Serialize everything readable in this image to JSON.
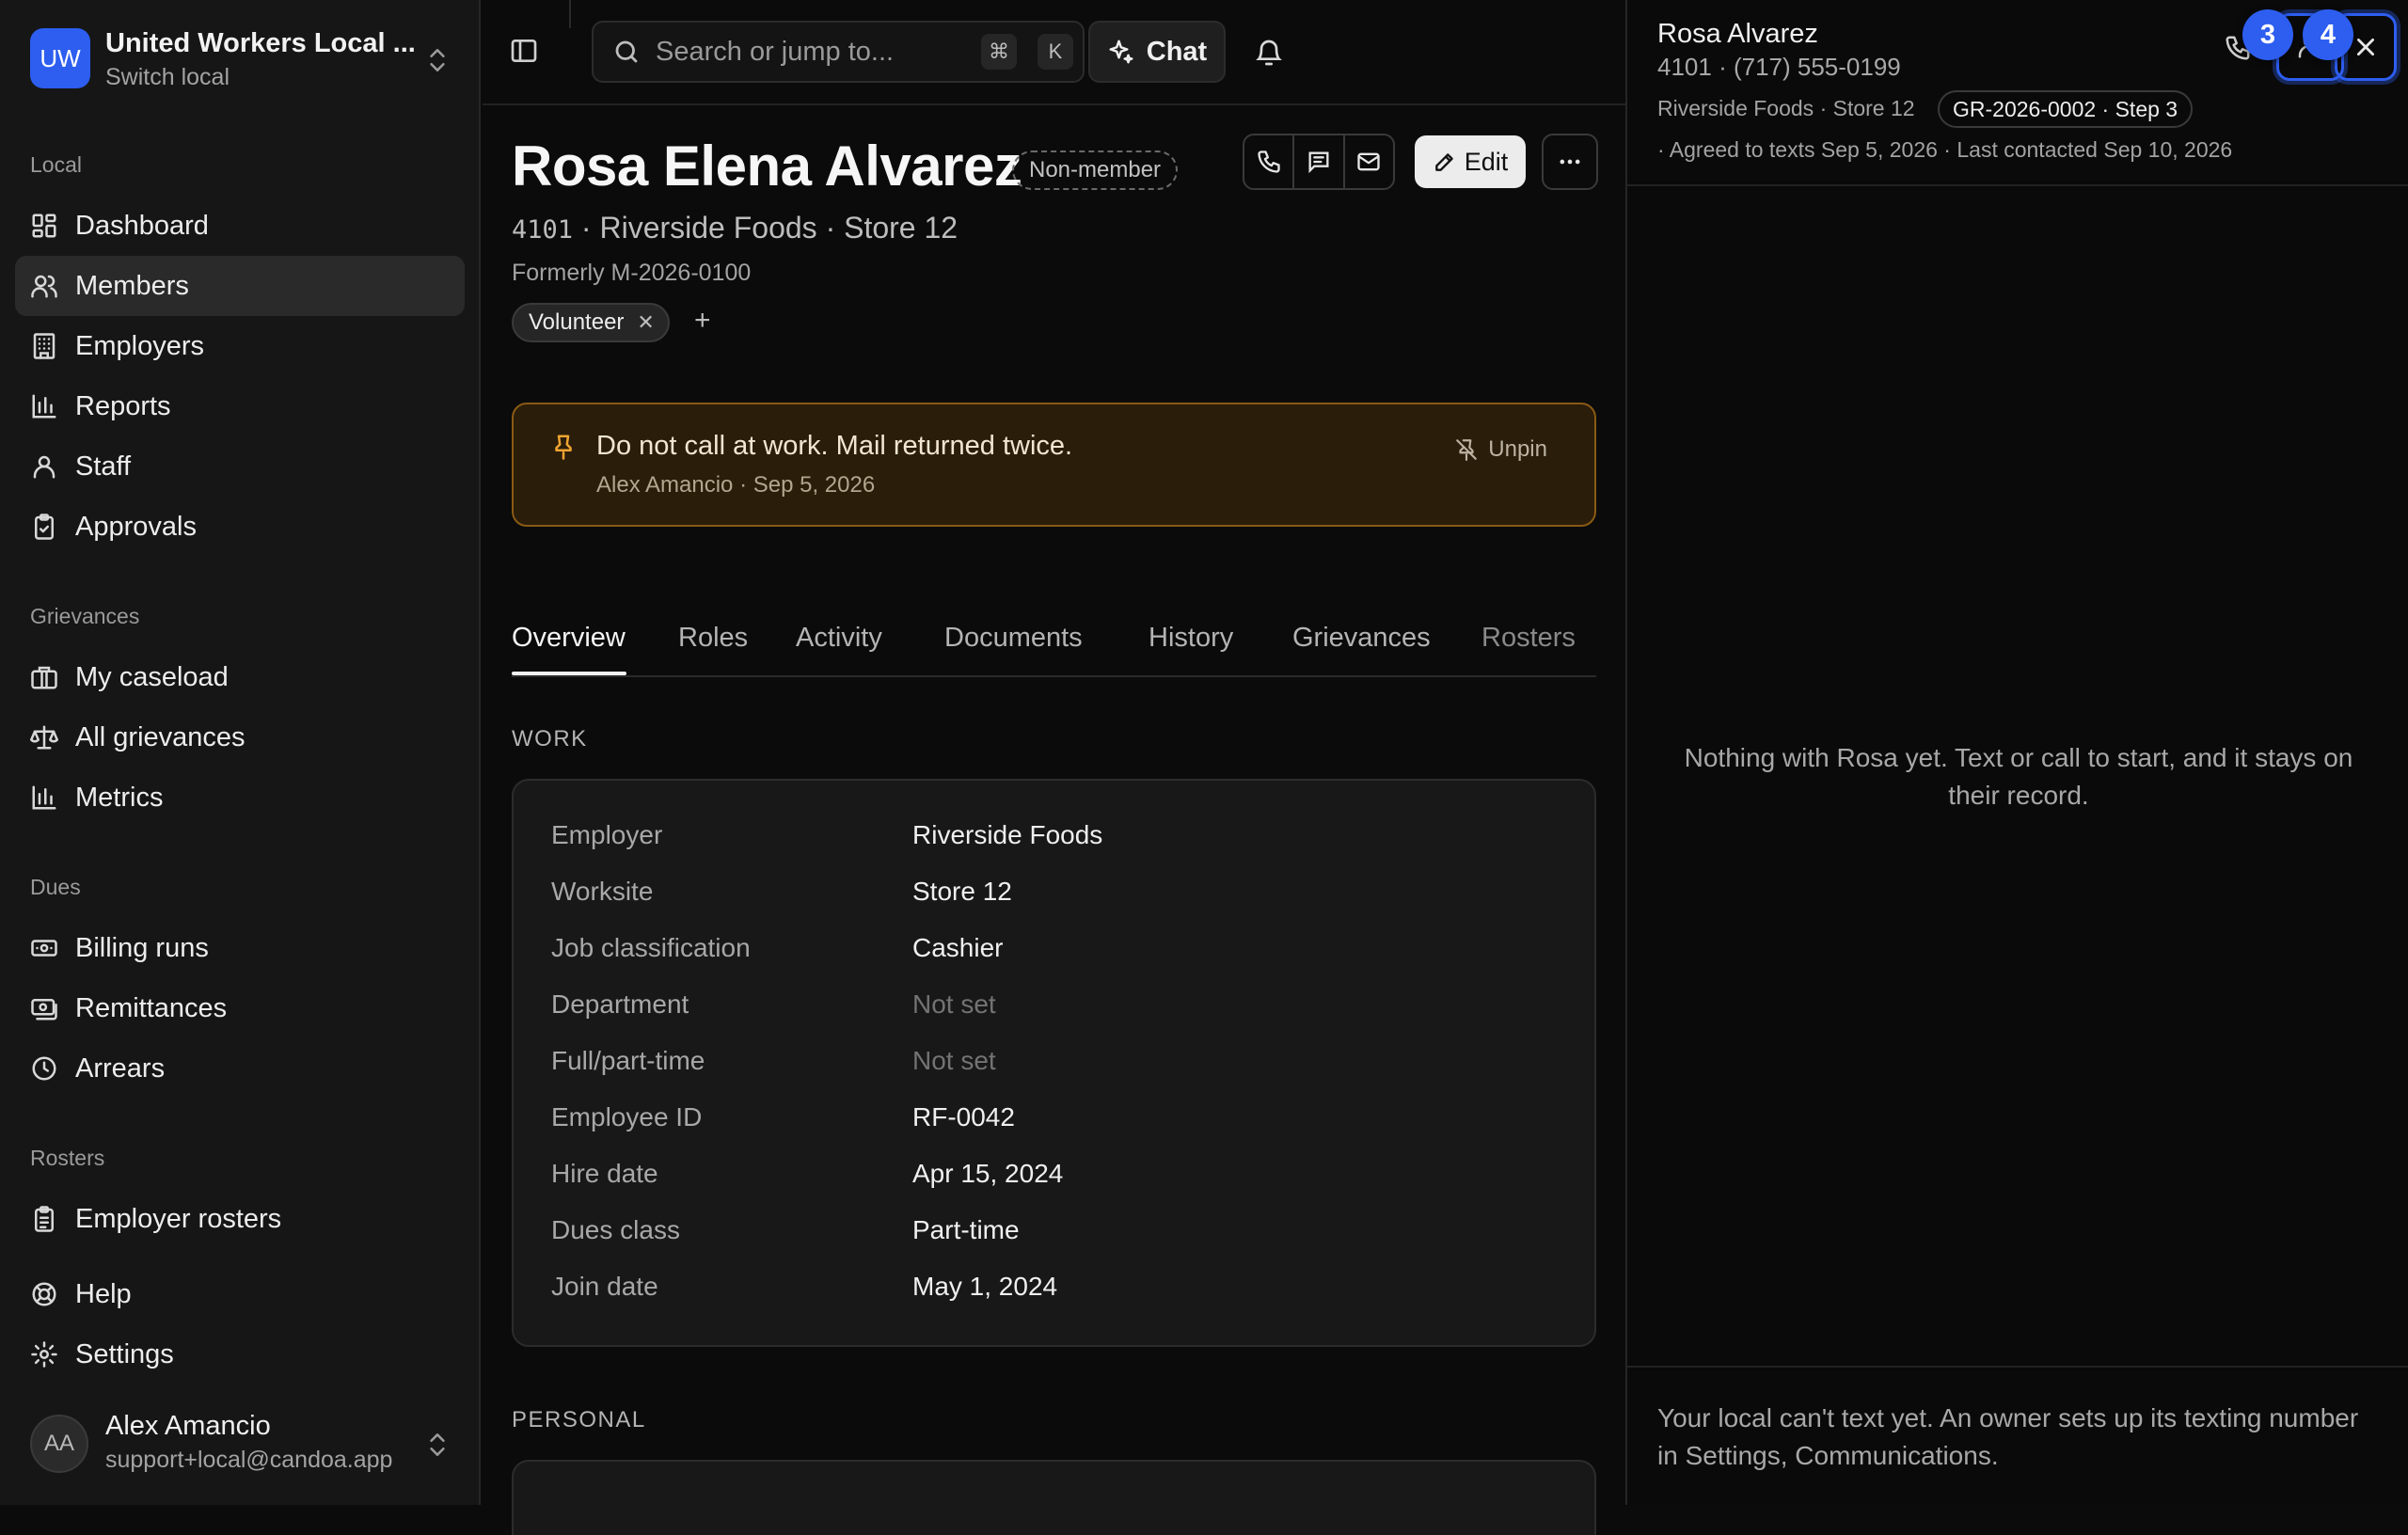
{
  "org": {
    "initials": "UW",
    "name": "United Workers Local ...",
    "switch_label": "Switch local"
  },
  "sidebar": {
    "sections": [
      {
        "label": "Local"
      },
      {
        "label": "Grievances"
      },
      {
        "label": "Dues"
      },
      {
        "label": "Rosters"
      }
    ],
    "items": [
      {
        "label": "Dashboard",
        "icon": "dashboard-icon"
      },
      {
        "label": "Members",
        "icon": "users-icon",
        "active": true
      },
      {
        "label": "Employers",
        "icon": "building-icon"
      },
      {
        "label": "Reports",
        "icon": "bar-chart-icon"
      },
      {
        "label": "Staff",
        "icon": "person-icon"
      },
      {
        "label": "Approvals",
        "icon": "clipboard-check-icon"
      },
      {
        "label": "My caseload",
        "icon": "briefcase-icon"
      },
      {
        "label": "All grievances",
        "icon": "scale-icon"
      },
      {
        "label": "Metrics",
        "icon": "bar-chart-icon"
      },
      {
        "label": "Billing runs",
        "icon": "banknote-icon"
      },
      {
        "label": "Remittances",
        "icon": "receipt-icon"
      },
      {
        "label": "Arrears",
        "icon": "clock-icon"
      },
      {
        "label": "Employer rosters",
        "icon": "clipboard-list-icon"
      },
      {
        "label": "Help",
        "icon": "lifebuoy-icon"
      },
      {
        "label": "Settings",
        "icon": "gear-icon"
      }
    ]
  },
  "user": {
    "initials": "AA",
    "name": "Alex Amancio",
    "email": "support+local@candoa.app"
  },
  "topbar": {
    "search_placeholder": "Search or jump to...",
    "kbd_cmd": "⌘",
    "kbd_k": "K",
    "chat_label": "Chat"
  },
  "person": {
    "full_name": "Rosa Elena Alvarez",
    "status_badge": "Non-member",
    "local_number": "4101",
    "employer_line": "· Riverside Foods · Store 12",
    "formerly": "Formerly M-2026-0100",
    "tags": [
      "Volunteer"
    ],
    "edit_label": "Edit"
  },
  "pinned_note": {
    "text": "Do not call at work. Mail returned twice.",
    "meta": "Alex Amancio · Sep 5, 2026",
    "unpin_label": "Unpin"
  },
  "tabs": [
    "Overview",
    "Roles",
    "Activity",
    "Documents",
    "History",
    "Grievances",
    "Rosters"
  ],
  "work": {
    "title": "WORK",
    "rows": [
      {
        "label": "Employer",
        "value": "Riverside Foods"
      },
      {
        "label": "Worksite",
        "value": "Store 12"
      },
      {
        "label": "Job classification",
        "value": "Cashier"
      },
      {
        "label": "Department",
        "value": "Not set",
        "muted": true
      },
      {
        "label": "Full/part-time",
        "value": "Not set",
        "muted": true
      },
      {
        "label": "Employee ID",
        "value": "RF-0042"
      },
      {
        "label": "Hire date",
        "value": "Apr 15, 2024"
      },
      {
        "label": "Dues class",
        "value": "Part-time"
      },
      {
        "label": "Join date",
        "value": "May 1, 2024"
      }
    ]
  },
  "personal": {
    "title": "PERSONAL"
  },
  "panel": {
    "name": "Rosa Alvarez",
    "phone_line": "4101 · (717) 555-0199",
    "employer_line": "Riverside Foods · Store 12",
    "grievance_chip": "GR-2026-0002 · Step 3",
    "meta_line": "· Agreed to texts Sep 5, 2026  · Last contacted Sep 10, 2026",
    "empty_text": "Nothing with Rosa yet. Text or call to start, and it stays on their record.",
    "footer_text": "Your local can't text yet. An owner sets up its texting number in Settings, Communications.",
    "step_badges": [
      "3",
      "4"
    ]
  },
  "colors": {
    "accent": "#2d5ef0",
    "pinned_bg": "#2a1d0a",
    "pinned_border": "#8a5a14",
    "pin_icon": "#f0a531"
  }
}
